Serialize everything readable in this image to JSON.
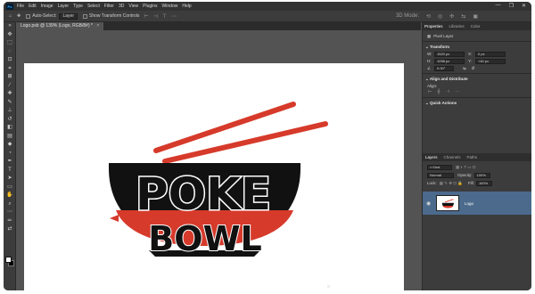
{
  "app": {
    "logo": "Ps"
  },
  "menu": [
    "File",
    "Edit",
    "Image",
    "Layer",
    "Type",
    "Select",
    "Filter",
    "3D",
    "View",
    "Plugins",
    "Window",
    "Help"
  ],
  "window_controls": [
    "—",
    "❐",
    "✕"
  ],
  "options_bar": {
    "auto_select_label": "Auto-Select:",
    "auto_select_value": "Layer",
    "transform_controls_label": "Show Transform Controls",
    "mode_label": "3D Mode:"
  },
  "document": {
    "tab_title": "Logo.psb @ 139% (Logo, RGB/8#) *",
    "close": "×"
  },
  "artwork": {
    "line1": "POKE",
    "line2": "BOWL",
    "colors": {
      "black": "#111111",
      "red": "#d63a2b"
    }
  },
  "properties_panel": {
    "tabs": [
      "Properties",
      "Libraries",
      "Color"
    ],
    "layer_type": "Pixel Layer",
    "transform_header": "Transform",
    "w_label": "W:",
    "w_value": "1520 px",
    "x_label": "X:",
    "x_value": "0 px",
    "h_label": "H:",
    "h_value": "1098 px",
    "y_label": "Y:",
    "y_value": "+40 px",
    "angle_value": "0.00°",
    "align_header": "Align and Distribute",
    "align_label": "Align:",
    "quick_actions_header": "Quick Actions"
  },
  "layers_panel": {
    "tabs": [
      "Layers",
      "Channels",
      "Paths"
    ],
    "filter_label": "Kind",
    "blend_mode": "Normal",
    "opacity_label": "Opacity:",
    "opacity_value": "100%",
    "lock_label": "Lock:",
    "fill_label": "Fill:",
    "fill_value": "100%",
    "layer_name": "Logo"
  },
  "colors": {
    "ui_dark": "#323232",
    "ui_panel": "#3c3c3c",
    "ui_canvas_bg": "#535353",
    "layer_selected": "#4b6a8c"
  }
}
